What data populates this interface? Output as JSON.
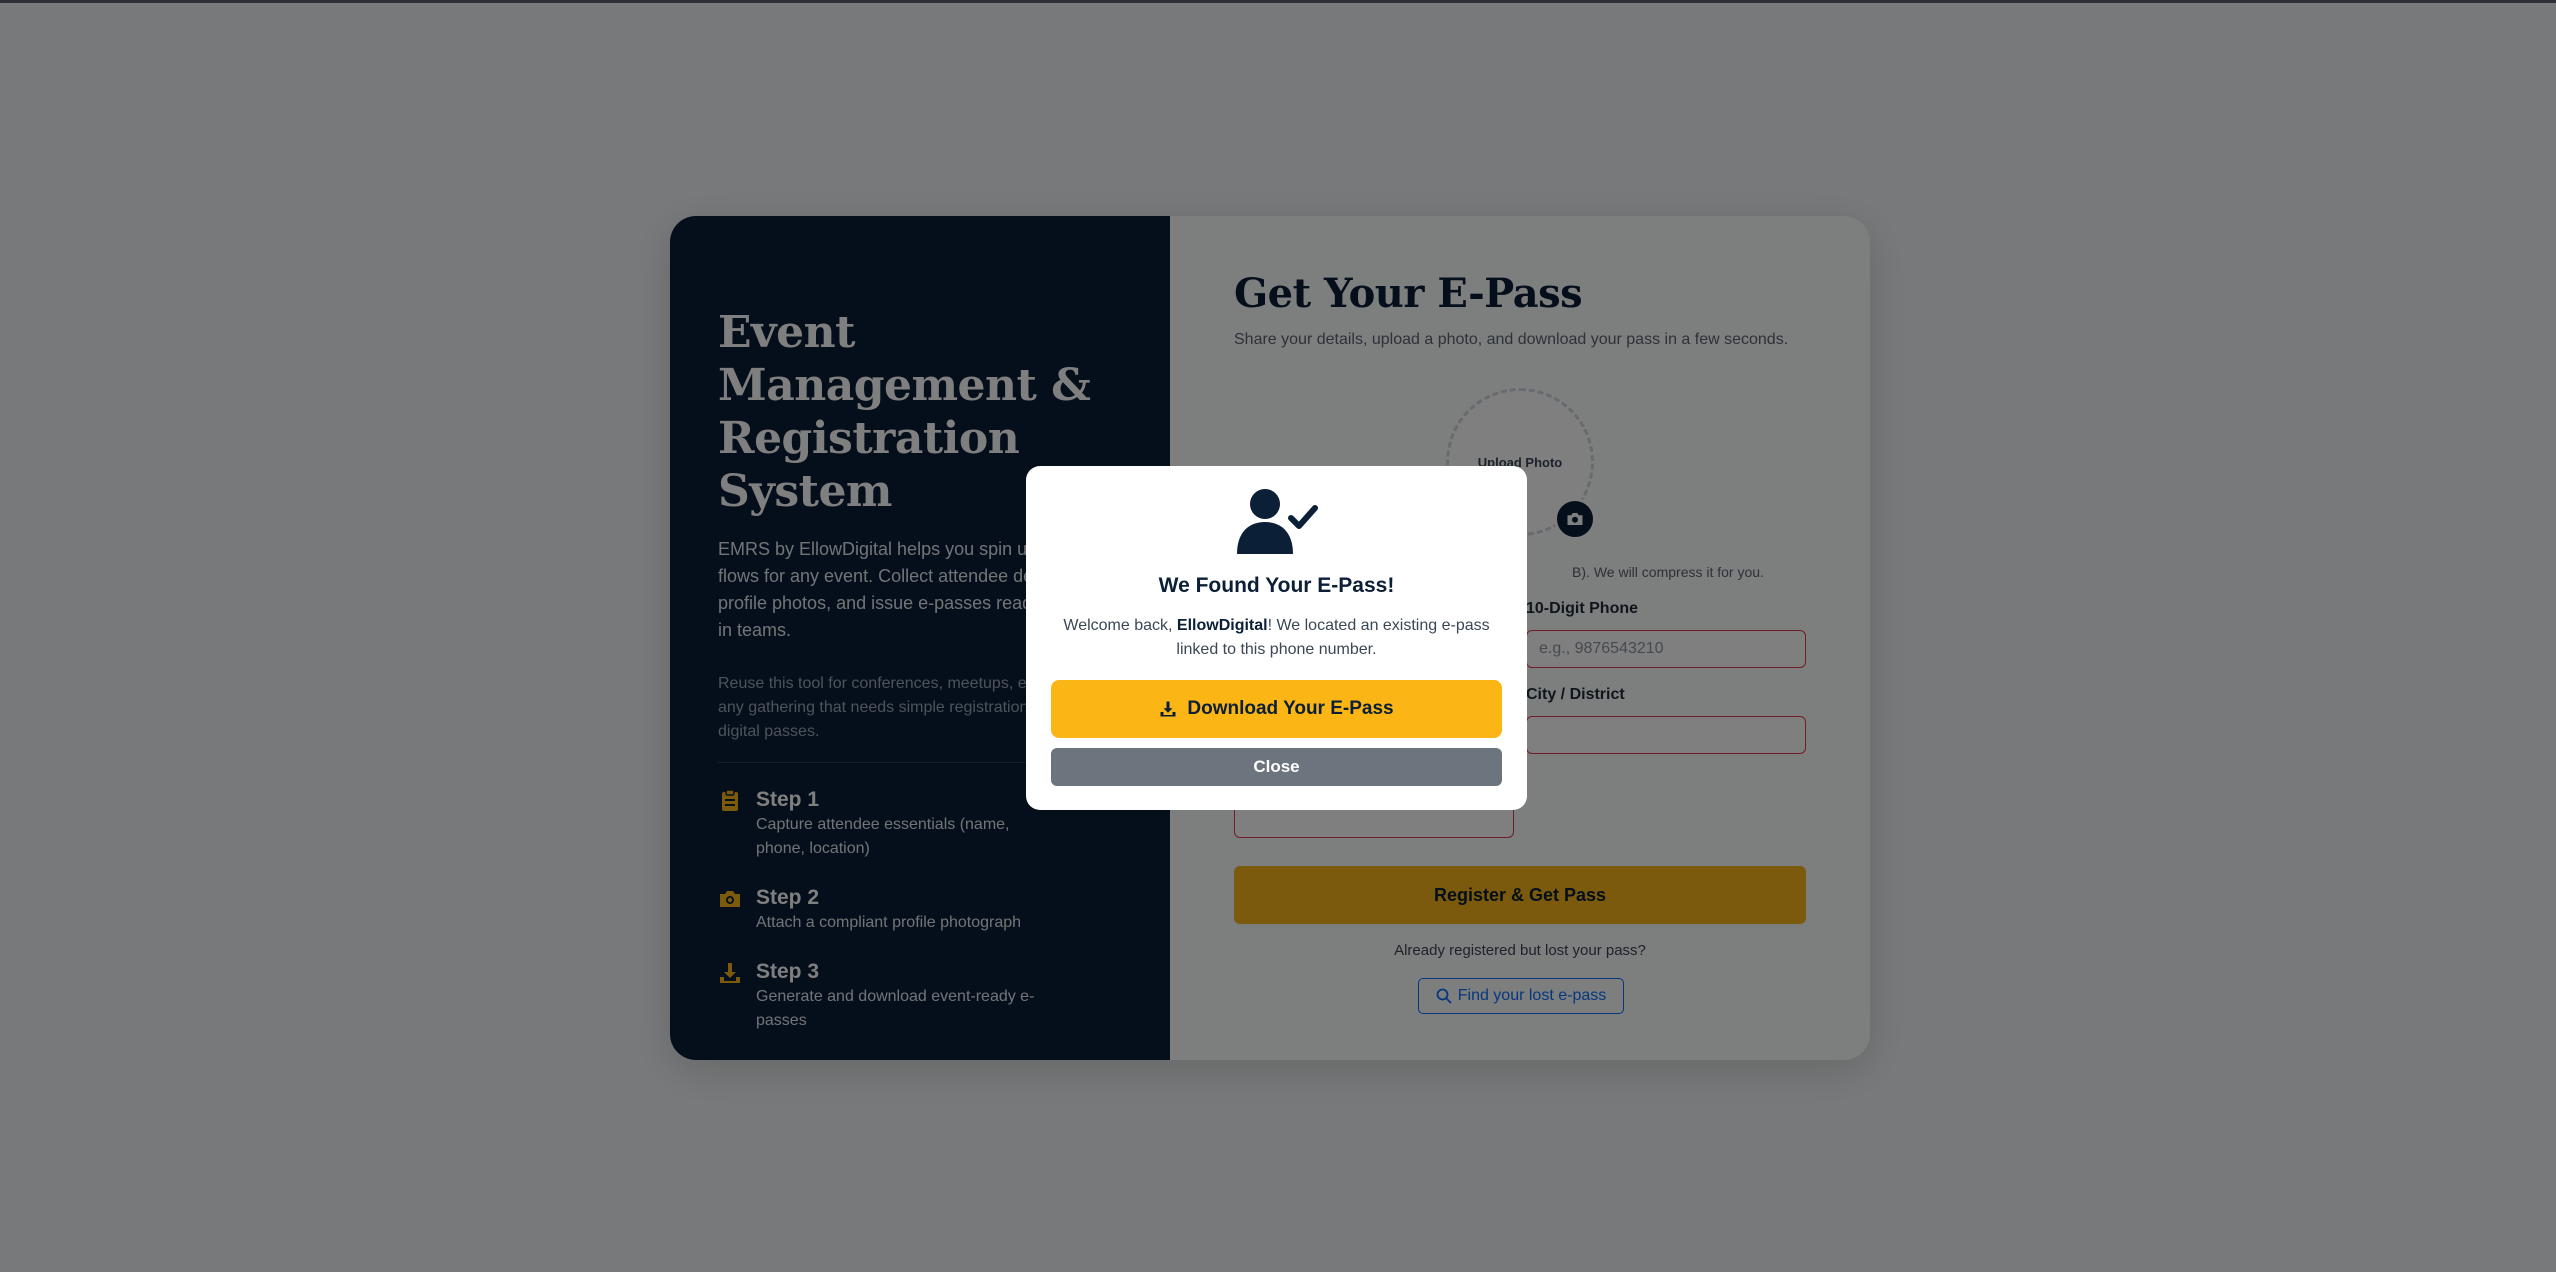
{
  "left": {
    "title": "Event Management & Registration System",
    "description": "EMRS by EllowDigital helps you spin up registration flows for any event. Collect attendee details, capture profile photos, and issue e-passes ready for check-in teams.",
    "secondary": "Reuse this tool for conferences, meetups, exhibitions, or any gathering that needs simple registration and instant digital passes.",
    "steps": [
      {
        "title": "Step 1",
        "text": "Capture attendee essentials (name, phone, location)",
        "icon": "clipboard-icon"
      },
      {
        "title": "Step 2",
        "text": "Attach a compliant profile photograph",
        "icon": "camera-icon"
      },
      {
        "title": "Step 3",
        "text": "Generate and download event-ready e-passes",
        "icon": "download-icon"
      }
    ]
  },
  "form": {
    "title": "Get Your E-Pass",
    "subtitle": "Share your details, upload a photo, and download your pass in a few seconds.",
    "photo_label": "Upload Photo",
    "photo_hint": "B). We will compress it for you.",
    "phone_label": "10-Digit Phone",
    "phone_placeholder": "e.g., 9876543210",
    "city_label": "City / District",
    "submit_label": "Register & Get Pass",
    "lost_text": "Already registered but lost your pass?",
    "find_label": "Find your lost e-pass"
  },
  "modal": {
    "title": "We Found Your E-Pass!",
    "message_prefix": "Welcome back, ",
    "user_name": "EllowDigital",
    "message_suffix": "! We located an existing e-pass linked to this phone number.",
    "download_label": "Download Your E-Pass",
    "close_label": "Close"
  },
  "colors": {
    "navy": "#0b1f36",
    "accent": "#fbb616",
    "link": "#0d6efd",
    "error": "#e23b4e"
  }
}
